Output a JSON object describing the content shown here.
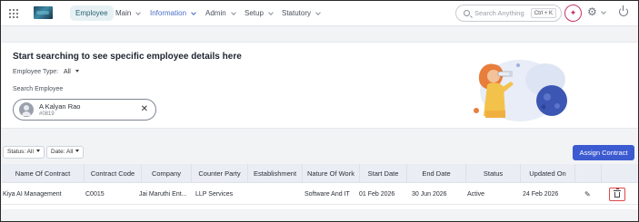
{
  "colors": {
    "accent": "#3d5bd1",
    "nav_active_bg": "#e7f1f4",
    "nav_active_text": "#4a6cc9",
    "ai_button": "#c7326a",
    "delete_highlight": "#e04848"
  },
  "topnav": {
    "items": [
      {
        "label": "Employee",
        "has_dropdown": false,
        "state": "selected"
      },
      {
        "label": "Main",
        "has_dropdown": true,
        "state": "normal"
      },
      {
        "label": "Information",
        "has_dropdown": true,
        "state": "active"
      },
      {
        "label": "Admin",
        "has_dropdown": true,
        "state": "normal"
      },
      {
        "label": "Setup",
        "has_dropdown": true,
        "state": "normal"
      },
      {
        "label": "Statutory",
        "has_dropdown": true,
        "state": "normal"
      }
    ],
    "search_placeholder": "Search Anything",
    "search_shortcut": "Ctrl + K",
    "icons": [
      "apps-grid-icon",
      "company-logo",
      "search-icon",
      "ai-sparkle-icon",
      "gear-icon",
      "chevron-down-icon",
      "power-icon"
    ]
  },
  "search_card": {
    "title": "Start searching to see specific employee details here",
    "employee_type_label": "Employee Type:",
    "employee_type_value": "All",
    "search_employee_label": "Search Employee",
    "selected_employee": {
      "name": "A Kalyan Rao",
      "code": "#0819"
    }
  },
  "filters": {
    "status": "Status: All",
    "date": "Date: All",
    "assign_button": "Assign Contract"
  },
  "table": {
    "columns": [
      "Name Of Contract",
      "Contract Code",
      "Company",
      "Counter Party",
      "Establishment",
      "Nature Of Work",
      "Start Date",
      "End Date",
      "Status",
      "Updated On",
      "",
      ""
    ],
    "rows": [
      {
        "name": "Kiya AI Management",
        "code": "C0015",
        "company": "Jai Maruthi Ent...",
        "counter_party": "LLP Services",
        "establishment": "",
        "nature_of_work": "Software And IT",
        "start_date": "01 Feb 2026",
        "end_date": "30 Jun 2026",
        "status": "Active",
        "updated_on": "24 Feb 2026"
      }
    ]
  }
}
